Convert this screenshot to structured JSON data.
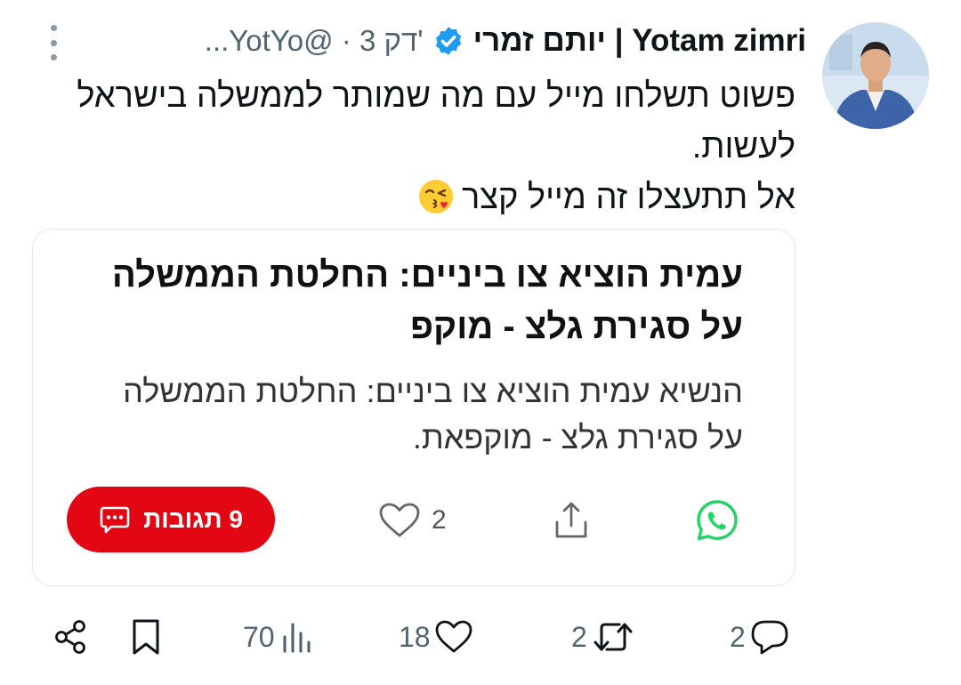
{
  "tweet": {
    "author_name": "יותם זמרי | Yotam zimri",
    "meta": "...YotYo@ · 3 דק'",
    "lines": [
      "פשוט תשלחו מייל עם מה שמותר לממשלה בישראל",
      "לעשות.",
      "אל תתעצלו זה מייל קצר"
    ],
    "emoji_icon": "kissing-face-icon"
  },
  "card": {
    "title_lines": [
      "עמית הוציא צו ביניים: החלטת הממשלה",
      "על סגירת גלצ - מוקפ"
    ],
    "desc_lines": [
      "הנשיא עמית הוציא צו ביניים: החלטת הממשלה",
      "על סגירת גלצ - מוקפאת."
    ],
    "comments_label": "9 תגובות",
    "like_count": "2",
    "comments_color": "#e30613",
    "whatsapp_color": "#25d366"
  },
  "actions": {
    "reply_count": "2",
    "repost_count": "2",
    "like_count": "18",
    "views_count": "70"
  },
  "colors": {
    "text": "#0f1419",
    "muted": "#536471",
    "verified": "#1d9bf0"
  }
}
